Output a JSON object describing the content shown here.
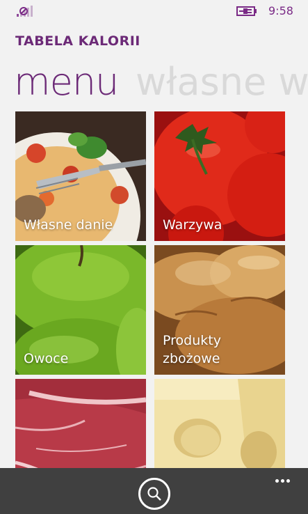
{
  "status_bar": {
    "time": "9:58",
    "signal_icon": "signal-strength-icon",
    "battery_icon": "battery-charging-icon"
  },
  "app": {
    "title": "TABELA KALORII"
  },
  "pivot": {
    "active": "menu",
    "inactive": "własne w"
  },
  "tiles": [
    {
      "label": "Własne danie",
      "icon": "pasta-dish-image"
    },
    {
      "label": "Warzywa",
      "icon": "tomatoes-image"
    },
    {
      "label": "Owoce",
      "icon": "green-apples-image"
    },
    {
      "label_line1": "Produkty",
      "label_line2": "zbożowe",
      "icon": "bread-image"
    },
    {
      "label": "",
      "icon": "raw-meat-image"
    },
    {
      "label": "",
      "icon": "cheese-image"
    }
  ],
  "app_bar": {
    "search_icon": "search-icon",
    "more_icon": "more-ellipsis-icon"
  },
  "colors": {
    "accent": "#6c2a77",
    "background": "#f2f2f2",
    "app_bar": "#404040"
  }
}
